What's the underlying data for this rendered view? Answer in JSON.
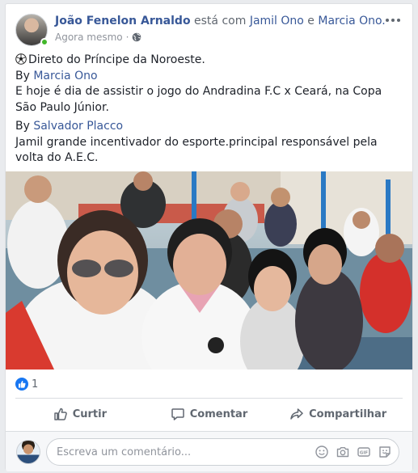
{
  "post": {
    "author": "João Fenelon Arnaldo",
    "with_text": " está com ",
    "tag1": "Jamil Ono",
    "and_text": " e ",
    "tag2": "Marcia Ono.",
    "timestamp": "Agora mesmo",
    "separator": "·",
    "privacy_icon": "globe-icon",
    "more_icon": "more-options-icon",
    "text": {
      "line1": "Direto do Príncipe da Noroeste.",
      "by1_prefix": "By ",
      "by1_name": "Marcia Ono",
      "line3": "E hoje é dia de assistir o jogo do Andradina F.C x Ceará, na Copa São Paulo Júnior.",
      "by2_prefix": "By ",
      "by2_name": "Salvador Placco",
      "line5": "Jamil grande incentivador do esporte.principal responsável pela volta do A.E.C."
    }
  },
  "reactions": {
    "icon": "like-reaction-icon",
    "count": "1"
  },
  "actions": [
    {
      "label": "Curtir",
      "icon": "thumbs-up-icon"
    },
    {
      "label": "Comentar",
      "icon": "comment-icon"
    },
    {
      "label": "Compartilhar",
      "icon": "share-icon"
    }
  ],
  "comment_box": {
    "placeholder": "Escreva um comentário...",
    "icons": [
      "emoji-icon",
      "camera-icon",
      "gif-icon",
      "sticker-icon"
    ]
  },
  "colors": {
    "link": "#385898",
    "like": "#1877f2",
    "meta": "#90949c"
  }
}
